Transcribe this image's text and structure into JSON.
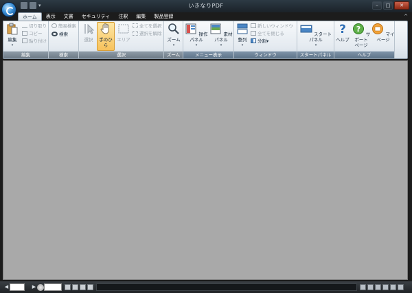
{
  "window": {
    "title": "いきなりPDF",
    "minimize": "–",
    "maximize": "□",
    "close": "✕"
  },
  "qat": {
    "dropdown": "▾"
  },
  "tabs": [
    {
      "label": "ホーム",
      "active": true
    },
    {
      "label": "表示"
    },
    {
      "label": "文書"
    },
    {
      "label": "セキュリティ"
    },
    {
      "label": "注釈"
    },
    {
      "label": "編集"
    },
    {
      "label": "製品登録"
    }
  ],
  "ribbon_collapse": "^",
  "groups": {
    "edit": {
      "label": "編集",
      "big": {
        "label": "編集",
        "dropdown": "▾"
      },
      "cut": "切り取り",
      "copy": "コピー",
      "paste": "貼り付け"
    },
    "search": {
      "label": "検索",
      "quick": "簡易検索",
      "search": "検索"
    },
    "select": {
      "label": "選択",
      "select": "選択",
      "hand": "手のひら",
      "area": "エリア",
      "select_all": "全てを選択",
      "deselect": "選択を解除"
    },
    "zoom": {
      "label": "ズーム",
      "zoom": "ズーム",
      "dropdown": "▾"
    },
    "menu": {
      "label": "メニュー表示",
      "operation": "操作パネル",
      "material": "素材パネル",
      "dropdown": "▾"
    },
    "window": {
      "label": "ウィンドウ",
      "arrange": "整列",
      "new_window": "新しいウィンドウ",
      "close_all": "全てを閉じる",
      "split": "分割",
      "dropdown": "▾"
    },
    "start": {
      "label": "スタートパネル",
      "start_panel": "スタートパネル",
      "dropdown": "▾"
    },
    "help": {
      "label": "ヘルプ",
      "help": "ヘルプ",
      "support_l1": "サポート",
      "support_l2": "ページ",
      "mypage": "マイページ"
    }
  },
  "status": {
    "prev": "◀",
    "next": "▶",
    "page_value": "",
    "zoom_value": ""
  },
  "colors": {
    "ribbon_bg": "#e4eaf0",
    "workspace_bg": "#a9a9a9",
    "titlebar_bg": "#1c1c1c",
    "highlight": "#f7c25c"
  }
}
